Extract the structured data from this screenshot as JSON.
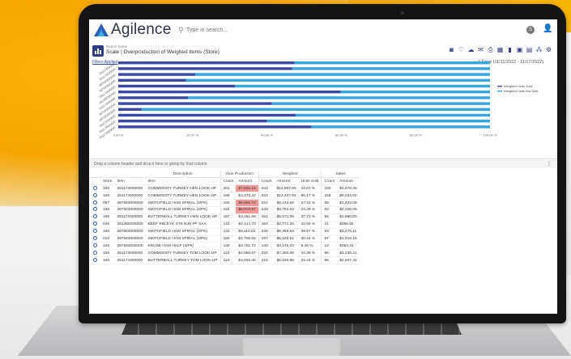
{
  "app": {
    "brand": "Agilence",
    "search_placeholder": "Type in search...",
    "user_initial": "S"
  },
  "report": {
    "label": "Report name",
    "title": "Scale | Overproduction of Weighed Items (Store)",
    "filters_link": "Filters Applied",
    "date_range": "7 Days (11/11/2022 - 11/17/2022)",
    "toolbar_icons": [
      "camera-icon",
      "heart-icon",
      "cloud-upload-icon",
      "mail-icon",
      "print-icon",
      "grid-icon",
      "trash-icon",
      "save-icon",
      "save-as-icon",
      "share-icon",
      "gear-icon"
    ]
  },
  "chart_data": {
    "type": "bar",
    "orientation": "horizontal",
    "stacked": "percent",
    "categories": [
      "261174000000",
      "261174000000",
      "287563000000",
      "287563000000",
      "281174400000",
      "261382000000",
      "261174000000",
      "287563000000",
      "287563000000",
      "261174000000",
      "261174400000",
      "261174000000"
    ],
    "series": [
      {
        "name": "Weighed Units Sold",
        "color": "#3b48a8",
        "values": [
          47.4,
          46.8,
          20.7,
          18.2,
          31.4,
          59.8,
          18.8,
          41.3,
          6.3,
          47.7,
          40.0,
          52.0
        ]
      },
      {
        "name": "Weighed Units Not Sold",
        "color": "#34a6e4",
        "values": [
          52.6,
          53.2,
          79.3,
          81.8,
          68.6,
          40.2,
          81.2,
          58.7,
          93.7,
          52.3,
          60.0,
          48.0
        ]
      }
    ],
    "x_ticks": [
      "0.00 %",
      "20.00 %",
      "40.00 %",
      "60.00 %",
      "80.00 %",
      "100.00 %"
    ],
    "xlim": [
      0,
      100
    ],
    "legend_position": "right",
    "grid": false
  },
  "grid": {
    "group_hint": "Drag a column header and drop it here to group by that column",
    "group_headers": [
      "Description",
      "Over Production",
      "Weighed",
      "Sales"
    ],
    "columns": [
      "Store",
      "Item",
      "Item",
      "Count",
      "Amount",
      "Count",
      "Amount",
      "Units Sold",
      "Count",
      "Amount"
    ],
    "rows": [
      [
        "106",
        "281174000000",
        "COMMODITY TURKEY HEN LOOK-UP",
        "201",
        "$7,632.16",
        "344",
        "$12,907.93",
        "44.67 %",
        "240",
        "$4,678.45"
      ],
      [
        "106",
        "281174000000",
        "COMMODITY TURKEY HEN LOOK-UP",
        "186",
        "$4,373.42",
        "334",
        "$13,407.92",
        "65.17 %",
        "348",
        "$9,034.50"
      ],
      [
        "097",
        "287563000000",
        "SMITHFIELD HAM SPIRAL (4/PK)",
        "160",
        "$6,656.72",
        "224",
        "$8,123.26",
        "17.41 %",
        "39",
        "$1,423.06"
      ],
      [
        "106",
        "287563000000",
        "SMITHFIELD HAM SPIRAL (4/PK)",
        "164",
        "$6,073.97",
        "243",
        "$8,784.02",
        "24.29 %",
        "63",
        "$2,208.05"
      ],
      [
        "106",
        "281174400000",
        "BUTTERBALL TURKEY HEN LOOK-UP",
        "167",
        "$3,461.69",
        "262",
        "$5,571.08",
        "37.73 %",
        "95",
        "$1,880.00"
      ],
      [
        "046",
        "261382000000",
        "BEEF RIB EYE STK BJN PF SAA",
        "143",
        "$2,414.70",
        "164",
        "$2,771.25",
        "10.93 %",
        "21",
        "$356.55"
      ],
      [
        "106",
        "287563000000",
        "SMITHFIELD HAM SPIRAL (4/PK)",
        "142",
        "$5,113.52",
        "235",
        "$8,396.63",
        "39.57 %",
        "93",
        "$3,278.11"
      ],
      [
        "012",
        "287563000000",
        "SMITHFIELD HAM SPIRAL (4/PK)",
        "150",
        "$4,708.55",
        "197",
        "$6,626.51",
        "30.44 %",
        "57",
        "$1,918.16"
      ],
      [
        "106",
        "287563000000",
        "KRUSE HAM HALF (4/PK)",
        "130",
        "$3,791.72",
        "142",
        "$4,146.03",
        "8.45 %",
        "12",
        "$354.31"
      ],
      [
        "106",
        "261174000000",
        "COMMODITY TURKEY TOM LOOK-UP",
        "124",
        "$4,566.67",
        "220",
        "$7,300.06",
        "44.39 %",
        "96",
        "$3,238.41"
      ],
      [
        "106",
        "261174400000",
        "BUTTERBALL TURKEY TOM LOOK-UP",
        "123",
        "$4,025.46",
        "216",
        "$6,630.86",
        "44.44 %",
        "96",
        "$2,607.42"
      ]
    ],
    "highlighted_cells": [
      [
        0,
        4
      ],
      [
        2,
        4
      ],
      [
        3,
        4
      ]
    ]
  }
}
